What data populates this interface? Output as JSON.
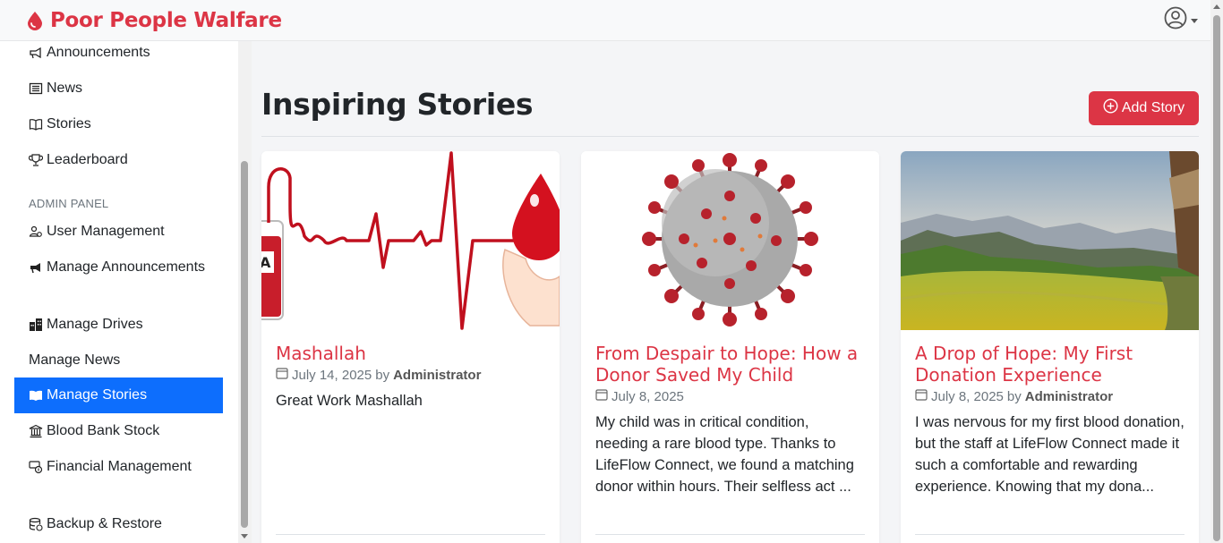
{
  "brand": {
    "name": "Poor People Walfare",
    "color": "#dc3545",
    "icon": "blood-drop-icon"
  },
  "user_menu": {
    "icon": "user-circle-icon"
  },
  "sidebar": {
    "items_top": [
      {
        "label": "Announcements",
        "icon": "megaphone-icon"
      },
      {
        "label": "News",
        "icon": "newspaper-icon"
      },
      {
        "label": "Stories",
        "icon": "book-icon"
      },
      {
        "label": "Leaderboard",
        "icon": "trophy-icon"
      }
    ],
    "admin_heading": "ADMIN PANEL",
    "admin_items": [
      {
        "label": "User Management",
        "icon": "users-icon"
      },
      {
        "label": "Manage Announcements",
        "icon": "megaphone-fill-icon"
      },
      {
        "label": "Manage Drives",
        "icon": "buildings-icon"
      },
      {
        "label": "Manage News",
        "icon": ""
      },
      {
        "label": "Manage Stories",
        "icon": "book-fill-icon",
        "active": true
      },
      {
        "label": "Blood Bank Stock",
        "icon": "bank-icon"
      },
      {
        "label": "Financial Management",
        "icon": "cash-coin-icon"
      },
      {
        "label": "Backup & Restore",
        "icon": "database-icon"
      }
    ],
    "active_color": "#0d6efd"
  },
  "main": {
    "title": "Inspiring Stories",
    "add_button": {
      "label": "Add Story",
      "icon": "plus-circle-icon",
      "color": "#dc3545"
    }
  },
  "stories": [
    {
      "title": "Mashallah",
      "date": "July 14, 2025",
      "by": "by",
      "author": "Administrator",
      "excerpt": "Great Work Mashallah",
      "image": "blood-donation-heartbeat-illustration"
    },
    {
      "title": "From Despair to Hope: How a Donor Saved My Child",
      "date": "July 8, 2025",
      "by": "",
      "author": "",
      "excerpt": "My child was in critical condition, needing a rare blood type. Thanks to LifeFlow Connect, we found a matching donor within hours. Their selfless act ...",
      "image": "virus-particle-photo"
    },
    {
      "title": "A Drop of Hope: My First Donation Experience",
      "date": "July 8, 2025",
      "by": "by",
      "author": "Administrator",
      "excerpt": "I was nervous for my first blood donation, but the staff at LifeFlow Connect made it such a comfortable and rewarding experience. Knowing that my dona...",
      "image": "rice-field-landscape-photo"
    }
  ]
}
